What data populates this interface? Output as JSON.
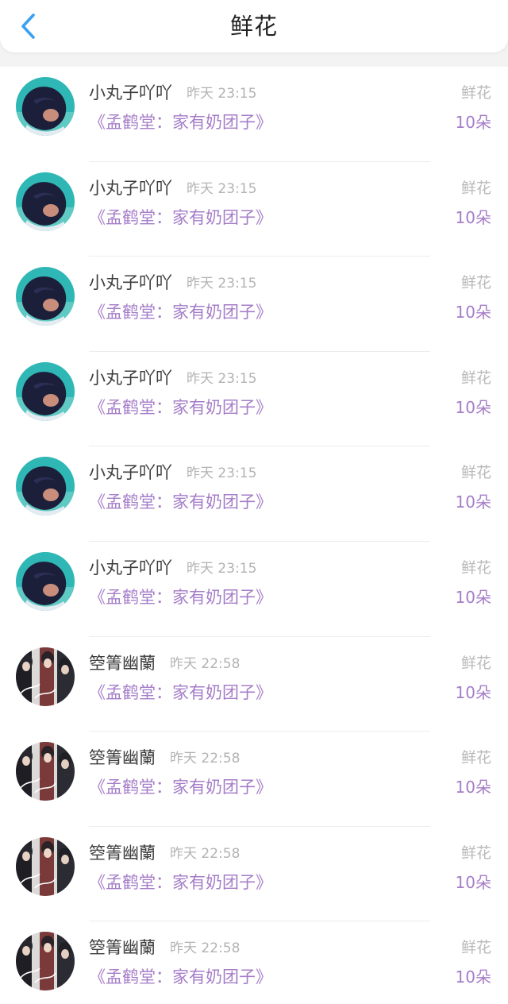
{
  "header": {
    "title": "鲜花",
    "back_icon": "chevron-left-icon"
  },
  "colors": {
    "accent_back": "#3aa0f0",
    "book_purple": "#a57dc8",
    "time_gray": "#b3b3b3"
  },
  "records": [
    {
      "name": "小丸子吖吖",
      "time": "昨天 23:15",
      "book": "《孟鹤堂：家有奶团子》",
      "gift": "鲜花",
      "count": "10朵",
      "avatar": "teal-avatar"
    },
    {
      "name": "小丸子吖吖",
      "time": "昨天 23:15",
      "book": "《孟鹤堂：家有奶团子》",
      "gift": "鲜花",
      "count": "10朵",
      "avatar": "teal-avatar"
    },
    {
      "name": "小丸子吖吖",
      "time": "昨天 23:15",
      "book": "《孟鹤堂：家有奶团子》",
      "gift": "鲜花",
      "count": "10朵",
      "avatar": "teal-avatar"
    },
    {
      "name": "小丸子吖吖",
      "time": "昨天 23:15",
      "book": "《孟鹤堂：家有奶团子》",
      "gift": "鲜花",
      "count": "10朵",
      "avatar": "teal-avatar"
    },
    {
      "name": "小丸子吖吖",
      "time": "昨天 23:15",
      "book": "《孟鹤堂：家有奶团子》",
      "gift": "鲜花",
      "count": "10朵",
      "avatar": "teal-avatar"
    },
    {
      "name": "小丸子吖吖",
      "time": "昨天 23:15",
      "book": "《孟鹤堂：家有奶团子》",
      "gift": "鲜花",
      "count": "10朵",
      "avatar": "teal-avatar"
    },
    {
      "name": "箜箐幽蘭",
      "time": "昨天 22:58",
      "book": "《孟鹤堂：家有奶团子》",
      "gift": "鲜花",
      "count": "10朵",
      "avatar": "portrait-avatar"
    },
    {
      "name": "箜箐幽蘭",
      "time": "昨天 22:58",
      "book": "《孟鹤堂：家有奶团子》",
      "gift": "鲜花",
      "count": "10朵",
      "avatar": "portrait-avatar"
    },
    {
      "name": "箜箐幽蘭",
      "time": "昨天 22:58",
      "book": "《孟鹤堂：家有奶团子》",
      "gift": "鲜花",
      "count": "10朵",
      "avatar": "portrait-avatar"
    },
    {
      "name": "箜箐幽蘭",
      "time": "昨天 22:58",
      "book": "《孟鹤堂：家有奶团子》",
      "gift": "鲜花",
      "count": "10朵",
      "avatar": "portrait-avatar"
    }
  ]
}
